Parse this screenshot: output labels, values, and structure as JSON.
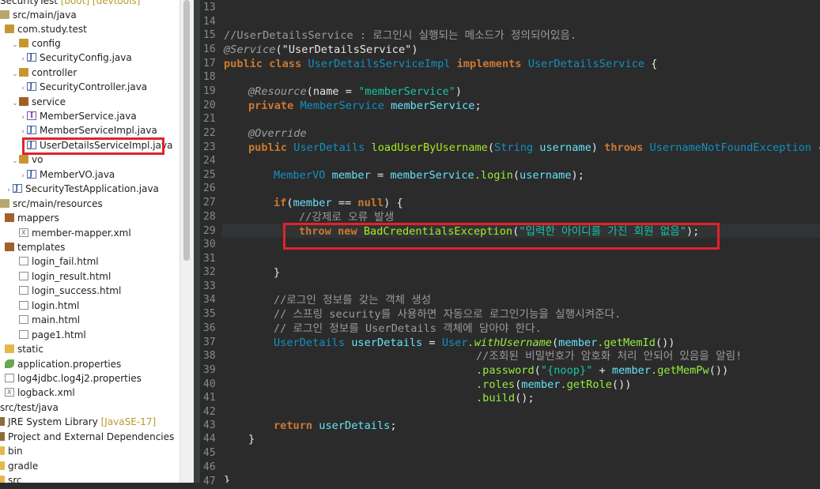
{
  "explorer": {
    "project": "SecurityTest",
    "project_deco": "[boot] [devtools]",
    "items": [
      {
        "label": "src/main/java"
      },
      {
        "label": "com.study.test"
      },
      {
        "label": "config"
      },
      {
        "label": "SecurityConfig.java"
      },
      {
        "label": "controller"
      },
      {
        "label": "SecurityController.java"
      },
      {
        "label": "service"
      },
      {
        "label": "MemberService.java"
      },
      {
        "label": "MemberServiceImpl.java"
      },
      {
        "label": "UserDetailsServiceImpl.java"
      },
      {
        "label": "vo"
      },
      {
        "label": "MemberVO.java"
      },
      {
        "label": "SecurityTestApplication.java"
      },
      {
        "label": "src/main/resources"
      },
      {
        "label": "mappers"
      },
      {
        "label": "member-mapper.xml"
      },
      {
        "label": "templates"
      },
      {
        "label": "login_fail.html"
      },
      {
        "label": "login_result.html"
      },
      {
        "label": "login_success.html"
      },
      {
        "label": "login.html"
      },
      {
        "label": "main.html"
      },
      {
        "label": "page1.html"
      },
      {
        "label": "static"
      },
      {
        "label": "application.properties"
      },
      {
        "label": "log4jdbc.log4j2.properties"
      },
      {
        "label": "logback.xml"
      },
      {
        "label": "src/test/java"
      },
      {
        "label": "JRE System Library"
      },
      {
        "label": "Project and External Dependencies"
      },
      {
        "label": "bin"
      },
      {
        "label": "gradle"
      },
      {
        "label": "src"
      }
    ],
    "jre_deco": "[JavaSE-17]"
  },
  "editor": {
    "line_numbers": [
      "13",
      "14",
      "15",
      "16",
      "17",
      "18",
      "19",
      "20",
      "21",
      "22",
      "23",
      "24",
      "25",
      "26",
      "27",
      "28",
      "29",
      "30",
      "31",
      "32",
      "33",
      "34",
      "35",
      "36",
      "37",
      "38",
      "39",
      "40",
      "41",
      "42",
      "43",
      "44",
      "45",
      "46",
      "47"
    ],
    "code": {
      "l15": "//UserDetailsService : 로그인시 실행되는 메소드가 정의되어있음.",
      "l16a": "@Service",
      "l16b": "(\"UserDetailsService\")",
      "l17a": "public class ",
      "l17b": "UserDetailsServiceImpl",
      "l17c": " implements ",
      "l17d": "UserDetailsService",
      "l17e": " {",
      "l19a": "@Resource",
      "l19b": "(name = ",
      "l19c": "\"memberService\"",
      "l19d": ")",
      "l20a": "private ",
      "l20b": "MemberService",
      "l20c": " memberService",
      "l20d": ";",
      "l22": "@Override",
      "l23a": "public ",
      "l23b": "UserDetails",
      "l23c": " loadUserByUsername",
      "l23d": "(",
      "l23e": "String",
      "l23f": " username",
      "l23g": ") ",
      "l23h": "throws ",
      "l23i": "UsernameNotFoundException",
      "l23j": " {",
      "l25a": "MemberVO",
      "l25b": " member",
      "l25c": " = ",
      "l25d": "memberService",
      "l25e": ".login",
      "l25f": "(",
      "l25g": "username",
      "l25h": ");",
      "l27a": "if",
      "l27b": "(",
      "l27c": "member",
      "l27d": " == ",
      "l27e": "null",
      "l27f": ") {",
      "l28": "//강제로 오류 발생",
      "l29a": "throw new ",
      "l29b": "BadCredentialsException",
      "l29c": "(",
      "l29d": "\"입력한 아이디를 가진 회원 없음\"",
      "l29e": ");",
      "l32": "}",
      "l34": "//로그인 정보를 갖는 객체 생성",
      "l35": "// 스프링 security를 사용하면 자동으로 로그인기능을 실행시켜준다.",
      "l36": "// 로그인 정보를 UserDetails 객체에 담아야 한다.",
      "l37a": "UserDetails",
      "l37b": " userDetails",
      "l37c": " = ",
      "l37d": "User",
      "l37e": ".withUsername",
      "l37f": "(",
      "l37g": "member",
      "l37h": ".getMemId",
      "l37i": "())",
      "l38": "//조회된 비밀번호가 암호화 처리 안되어 있음을 알림!",
      "l39a": ".password",
      "l39b": "(",
      "l39c": "\"{noop}\"",
      "l39d": " + ",
      "l39e": "member",
      "l39f": ".getMemPw",
      "l39g": "())",
      "l40a": ".roles",
      "l40b": "(",
      "l40c": "member",
      "l40d": ".getRole",
      "l40e": "())",
      "l41a": ".build",
      "l41b": "();",
      "l43a": "return ",
      "l43b": "userDetails",
      "l43c": ";",
      "l44": "}",
      "l47": "}"
    }
  },
  "colors": {
    "highlight_box": "#e1232b",
    "editor_bg": "#2b2b2b",
    "keyword": "#cc7832"
  }
}
